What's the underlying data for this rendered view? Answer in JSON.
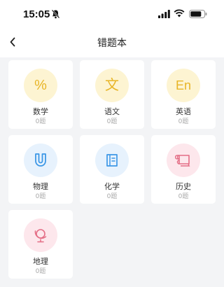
{
  "status": {
    "time": "15:05"
  },
  "header": {
    "title": "错题本"
  },
  "subjects": [
    {
      "name": "数学",
      "count": "0题",
      "glyph": "%"
    },
    {
      "name": "语文",
      "count": "0题",
      "glyph": "文"
    },
    {
      "name": "英语",
      "count": "0题",
      "glyph": "En"
    },
    {
      "name": "物理",
      "count": "0题"
    },
    {
      "name": "化学",
      "count": "0题"
    },
    {
      "name": "历史",
      "count": "0题"
    },
    {
      "name": "地理",
      "count": "0题"
    }
  ],
  "colors": {
    "yellow": "#e8b527",
    "blue": "#3c97e6",
    "pink": "#e46e86"
  },
  "icons": [
    "percent-icon",
    "wen-character-icon",
    "en-text-icon",
    "magnet-icon",
    "notebook-icon",
    "scroll-icon",
    "globe-icon"
  ]
}
